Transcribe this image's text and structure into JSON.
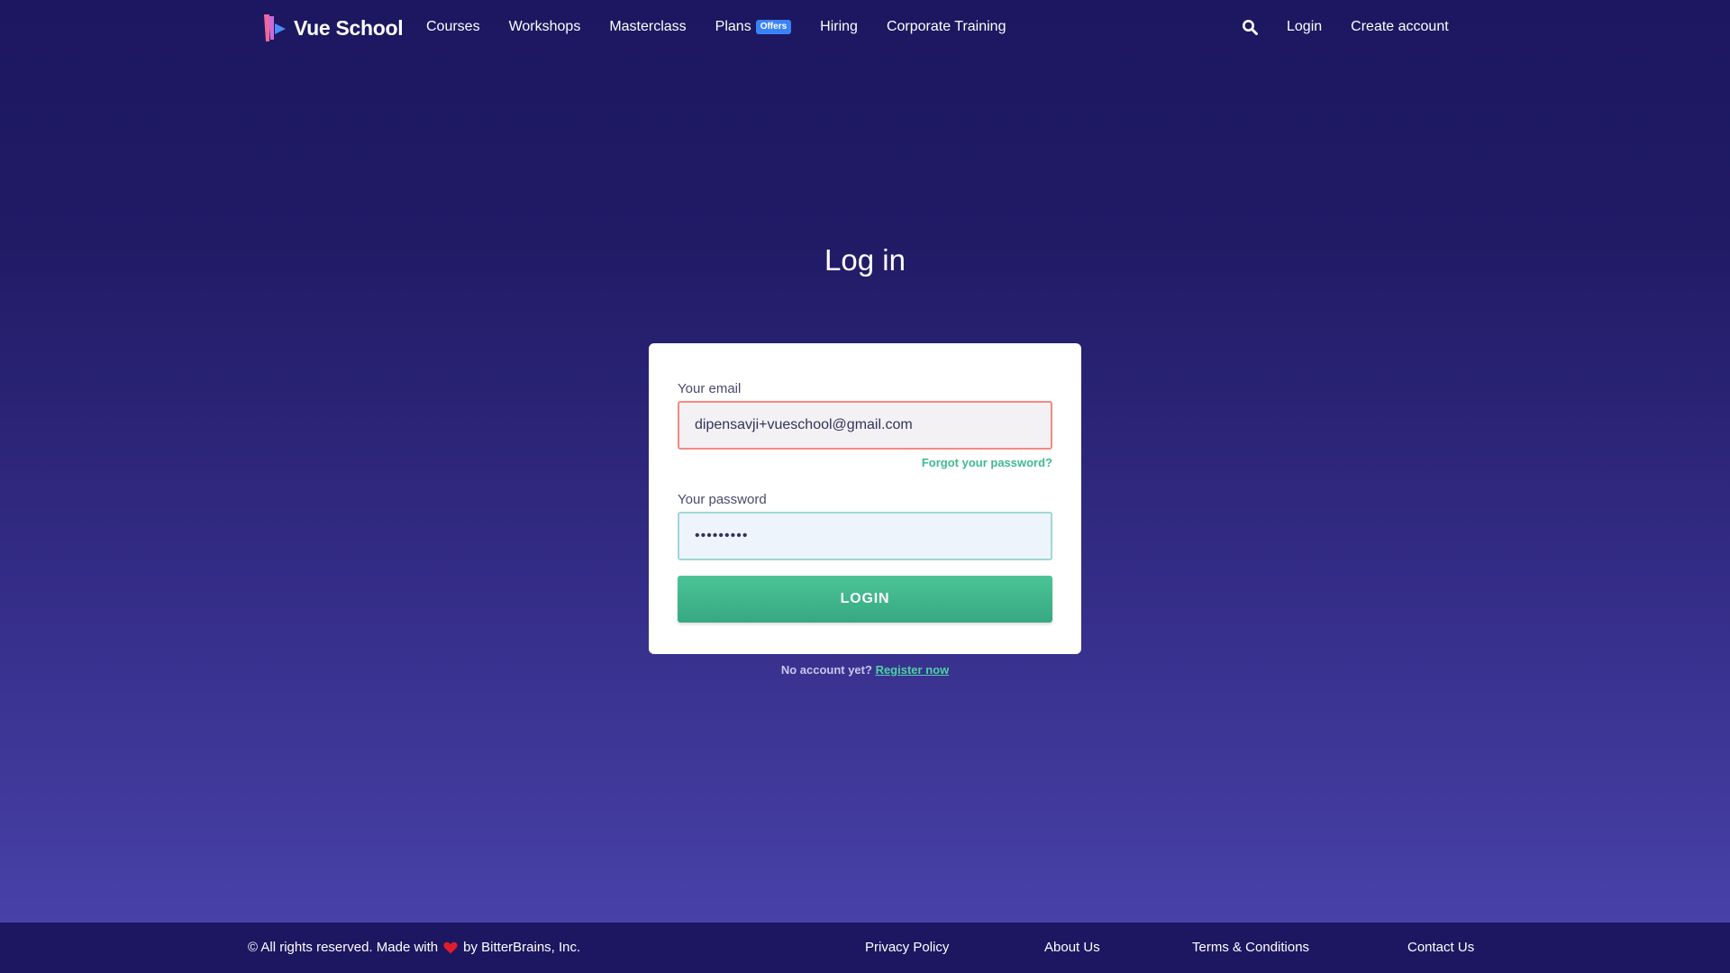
{
  "header": {
    "brand": "Vue School",
    "nav": [
      {
        "label": "Courses"
      },
      {
        "label": "Workshops"
      },
      {
        "label": "Masterclass"
      },
      {
        "label": "Plans",
        "badge": "Offers"
      },
      {
        "label": "Hiring"
      },
      {
        "label": "Corporate Training"
      }
    ],
    "search_icon": "search-icon",
    "login": "Login",
    "create_account": "Create account"
  },
  "main": {
    "title": "Log in",
    "email_label": "Your email",
    "email_value": "dipensavji+vueschool@gmail.com",
    "forgot_password": "Forgot your password?",
    "password_label": "Your password",
    "password_value": "•••••••••",
    "login_button": "LOGIN",
    "no_account": "No account yet?",
    "register": "Register now"
  },
  "footer": {
    "copyright_prefix": "© All rights reserved. Made with",
    "copyright_suffix": "by BitterBrains, Inc.",
    "heart_icon": "heart-icon",
    "links": [
      "Privacy Policy",
      "About Us",
      "Terms & Conditions",
      "Contact Us"
    ]
  },
  "colors": {
    "background_top": "#1c1760",
    "background_bottom": "#4b44ad",
    "accent_green": "#3fba8f",
    "error_border": "#f28b82",
    "badge_blue": "#3b82f6"
  }
}
